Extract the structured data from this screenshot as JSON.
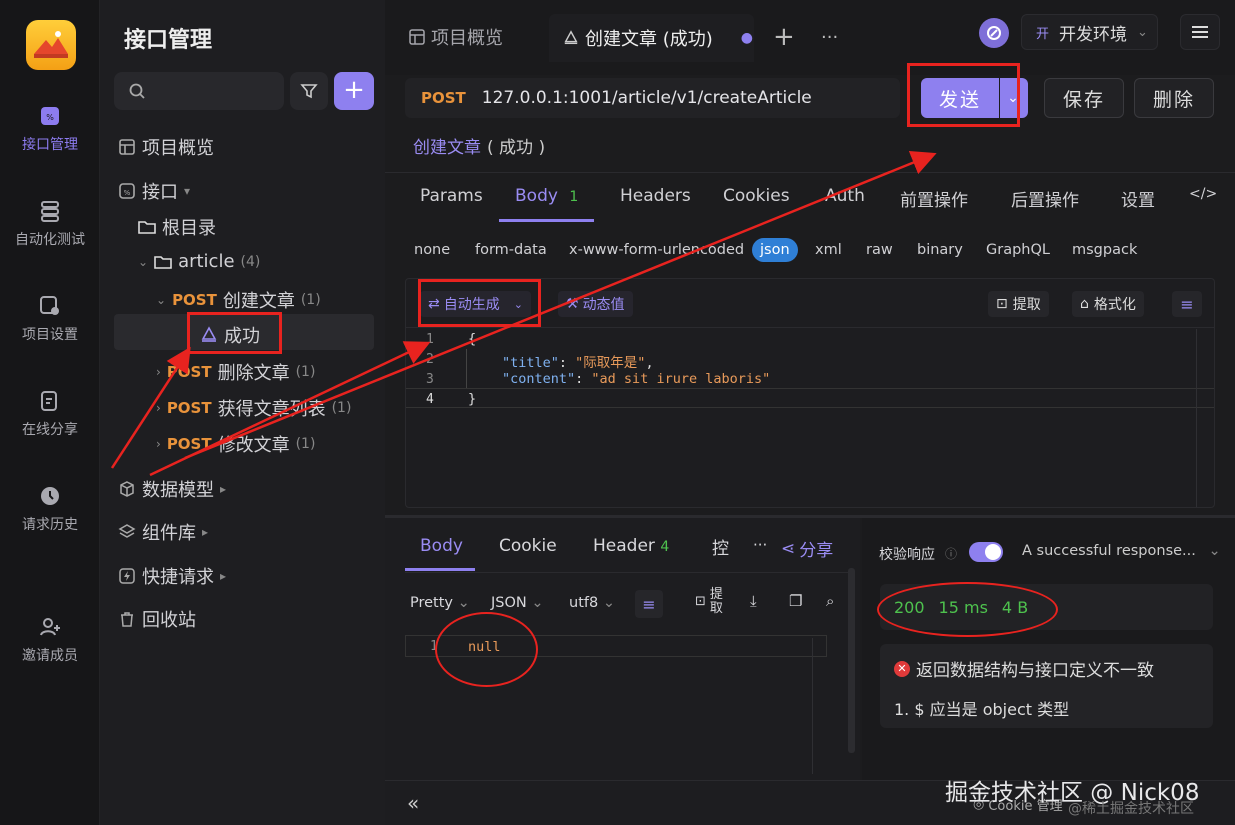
{
  "rail": {
    "items": [
      {
        "label": "接口管理",
        "icon": "api-icon",
        "active": true
      },
      {
        "label": "自动化测试",
        "icon": "automation-icon"
      },
      {
        "label": "项目设置",
        "icon": "project-settings-icon"
      },
      {
        "label": "在线分享",
        "icon": "share-doc-icon"
      },
      {
        "label": "请求历史",
        "icon": "history-icon"
      },
      {
        "label": "邀请成员",
        "icon": "invite-member-icon"
      }
    ]
  },
  "sidebar": {
    "title": "接口管理",
    "overview": "项目概览",
    "interface": "接口",
    "root": "根目录",
    "folder": {
      "name": "article",
      "count": "(4)"
    },
    "endpoints": [
      {
        "method": "POST",
        "name": "创建文章",
        "count": "(1)"
      },
      {
        "method": "POST",
        "name": "删除文章",
        "count": "(1)"
      },
      {
        "method": "POST",
        "name": "获得文章列表",
        "count": "(1)"
      },
      {
        "method": "POST",
        "name": "修改文章",
        "count": "(1)"
      }
    ],
    "case": "成功",
    "groups": [
      "数据模型",
      "组件库",
      "快捷请求",
      "回收站"
    ]
  },
  "tabs": {
    "overview": "项目概览",
    "active": "创建文章 (成功)",
    "plus": "+",
    "more": "···"
  },
  "env": {
    "badge": "开",
    "name": "开发环境"
  },
  "request": {
    "method": "POST",
    "url": "127.0.0.1:1001/article/v1/createArticle",
    "send": "发送",
    "save": "保存",
    "delete": "删除",
    "title_link": "创建文章",
    "title_suffix": "( 成功 )"
  },
  "req_tabs": [
    "Params",
    "Body",
    "Headers",
    "Cookies",
    "Auth",
    "前置操作",
    "后置操作",
    "设置",
    "</>"
  ],
  "body_count": "1",
  "body_types": [
    "none",
    "form-data",
    "x-www-form-urlencoded",
    "json",
    "xml",
    "raw",
    "binary",
    "GraphQL",
    "msgpack"
  ],
  "editor": {
    "auto_gen": "自动生成",
    "dynamic": "动态值",
    "extract": "提取",
    "format": "格式化",
    "line_numbers": [
      "1",
      "2",
      "3",
      "4"
    ],
    "lines": [
      {
        "text": "{"
      },
      {
        "key": "\"title\"",
        "value": "\"际取年是\""
      },
      {
        "key": "\"content\"",
        "value": "\"ad sit irure laboris\""
      },
      {
        "text": "}"
      }
    ]
  },
  "response": {
    "tabs": [
      "Body",
      "Cookie",
      "Header",
      "控"
    ],
    "header_count": "4",
    "share": "分享",
    "pretty": "Pretty",
    "json": "JSON",
    "utf8": "utf8",
    "extract": "提取",
    "line": "1",
    "content": "null"
  },
  "check": {
    "label": "校验响应",
    "select": "A successful response...",
    "status": "200",
    "time": "15 ms",
    "size": "4 B",
    "error_title": "返回数据结构与接口定义不一致",
    "error_detail": "1. $ 应当是 object 类型"
  },
  "bottom": {
    "cookie": "Cookie 管理",
    "watermark": "掘金技术社区 @ Nick08",
    "watermark2": "@稀土掘金技术社区"
  },
  "colors": {
    "accent": "#8e80ef",
    "post": "#e9933b",
    "annotation": "#e8231f",
    "success": "#4ec24e"
  }
}
